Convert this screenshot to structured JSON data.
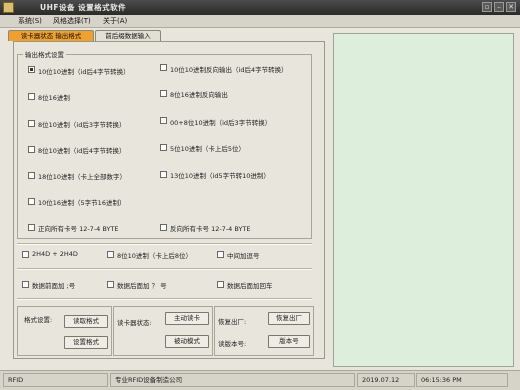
{
  "window": {
    "title": "UHF设备  设置格式软件",
    "controls": [
      "▫",
      "–",
      "✕"
    ]
  },
  "menu": [
    "系统(S)",
    "风格选择(T)",
    "关于(A)"
  ],
  "tabs": [
    "读卡器状态 输出格式",
    "前后缀数据输入"
  ],
  "output_group": {
    "title": "输出格式设置",
    "options": [
      {
        "label": "10位10进制（id后4字节转换）",
        "checked": true
      },
      {
        "label": "10位10进制反向输出（id后4字节转换）",
        "checked": false
      },
      {
        "label": "8位16进制",
        "checked": false
      },
      {
        "label": "8位16进制反向输出",
        "checked": false
      },
      {
        "label": "8位10进制（id后3字节转换）",
        "checked": false
      },
      {
        "label": "00+8位10进制（id后3字节转换）",
        "checked": false
      },
      {
        "label": "8位10进制（id后4字节转换）",
        "checked": false
      },
      {
        "label": "5位10进制（卡上后5位）",
        "checked": false
      },
      {
        "label": "18位10进制（卡上全部数字）",
        "checked": false
      },
      {
        "label": "13位10进制（id5字节转10进制）",
        "checked": false
      },
      {
        "label": "10位16进制（5字节16进制）",
        "checked": false
      },
      {
        "label": "正向所有卡号 12-7-4 BYTE",
        "checked": false
      },
      {
        "label": "反向所有卡号 12-7-4 BYTE",
        "checked": false
      }
    ]
  },
  "extra_row1": [
    {
      "label": "2H4D + 2H4D",
      "checked": false
    },
    {
      "label": "8位10进制（卡上后8位）",
      "checked": false
    },
    {
      "label": "中间加逗号",
      "checked": false
    }
  ],
  "extra_row2": [
    {
      "label": "数据前面加 ;号",
      "checked": false
    },
    {
      "label": "数据后面加 ？ 号",
      "checked": false
    },
    {
      "label": "数据后面加回车",
      "checked": false
    }
  ],
  "format_section": {
    "label": "格式设置:",
    "read_button": "读取格式",
    "set_button": "设置格式"
  },
  "reader_section": {
    "label": "读卡器状态:",
    "active_button": "主动读卡",
    "passive_button": "被动模式"
  },
  "factory_section": {
    "restore_label": "恢复出厂:",
    "restore_button": "恢复出厂",
    "version_label": "读版本号:",
    "version_button": "版本号"
  },
  "status_bar": {
    "name": "RFID",
    "company": "专业RFID设备制造公司",
    "date": "2019.07.12",
    "time": "06:15:36 PM"
  }
}
